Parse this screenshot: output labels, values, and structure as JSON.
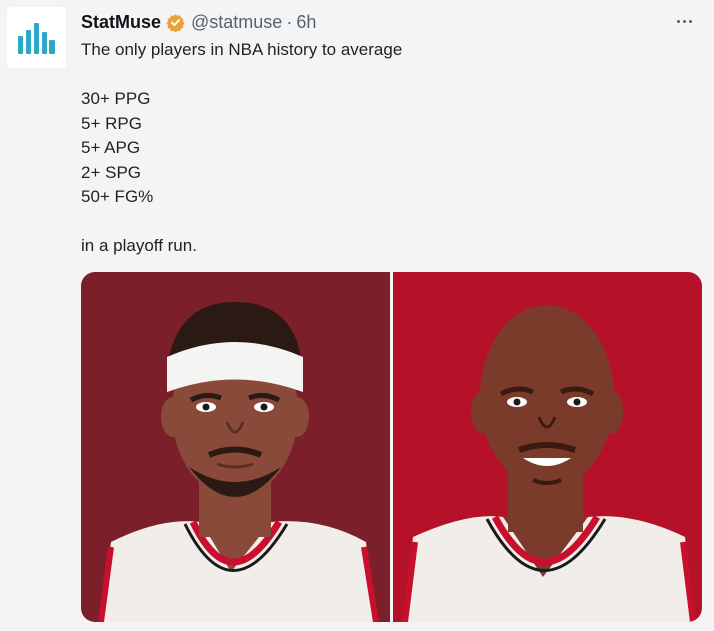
{
  "author": {
    "name": "StatMuse",
    "handle": "@statmuse",
    "separator": "·",
    "time": "6h"
  },
  "tweet": {
    "intro": "The only players in NBA history to average",
    "stats": [
      "30+ PPG",
      "5+ RPG",
      "5+ APG",
      "2+ SPG",
      "50+ FG%"
    ],
    "outro": "in a playoff run."
  },
  "colors": {
    "verified": "#e8a33b",
    "logo": "#2aa8c6",
    "left_bg": "#7b1f2b",
    "right_bg": "#b5122a"
  },
  "icons": {
    "avatar": "statmuse-logo",
    "verified": "verified-badge",
    "more": "more-icon"
  }
}
